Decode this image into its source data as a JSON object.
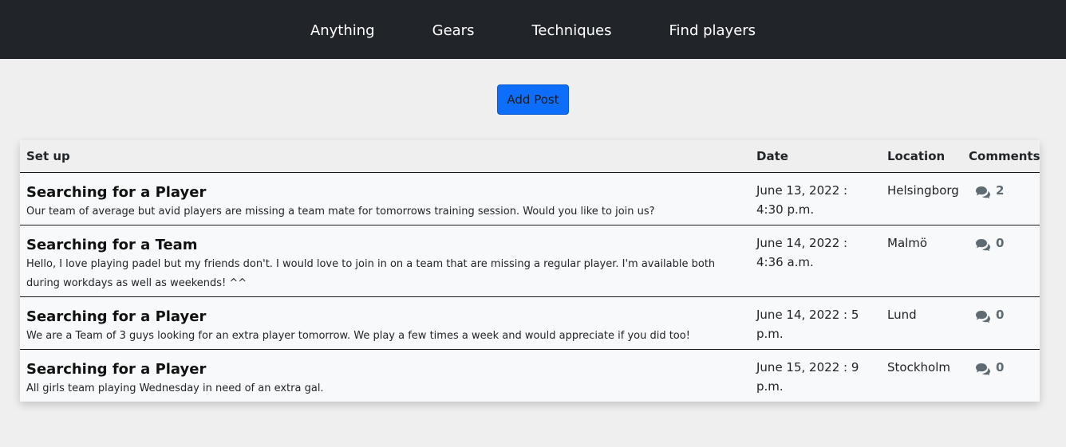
{
  "nav": {
    "items": [
      "Anything",
      "Gears",
      "Techniques",
      "Find players"
    ]
  },
  "actions": {
    "add_post_label": "Add Post"
  },
  "table": {
    "headers": {
      "setup": "Set up",
      "date": "Date",
      "location": "Location",
      "comments": "Comments"
    },
    "rows": [
      {
        "title": "Searching for a Player",
        "body": "Our team of average but avid players are missing a team mate for tomorrows training session. Would you like to join us?",
        "date": "June 13, 2022 : 4:30 p.m.",
        "location": "Helsingborg",
        "comments": "2"
      },
      {
        "title": "Searching for a Team",
        "body": "Hello, I love playing padel but my friends don't. I would love to join in on a team that are missing a regular player. I'm available both during workdays as well as weekends! ^^",
        "date": "June 14, 2022 : 4:36 a.m.",
        "location": "Malmö",
        "comments": "0"
      },
      {
        "title": "Searching for a Player",
        "body": "We are a Team of 3 guys looking for an extra player tomorrow. We play a few times a week and would appreciate if you did too!",
        "date": "June 14, 2022 : 5 p.m.",
        "location": "Lund",
        "comments": "0"
      },
      {
        "title": "Searching for a Player",
        "body": "All girls team playing Wednesday in need of an extra gal.",
        "date": "June 15, 2022 : 9 p.m.",
        "location": "Stockholm",
        "comments": "0"
      }
    ]
  },
  "icons": {
    "comments": "comments-icon"
  },
  "colors": {
    "navbar": "#212529",
    "primary_button": "#0d6efd",
    "comment_icon": "#5f6b73"
  }
}
